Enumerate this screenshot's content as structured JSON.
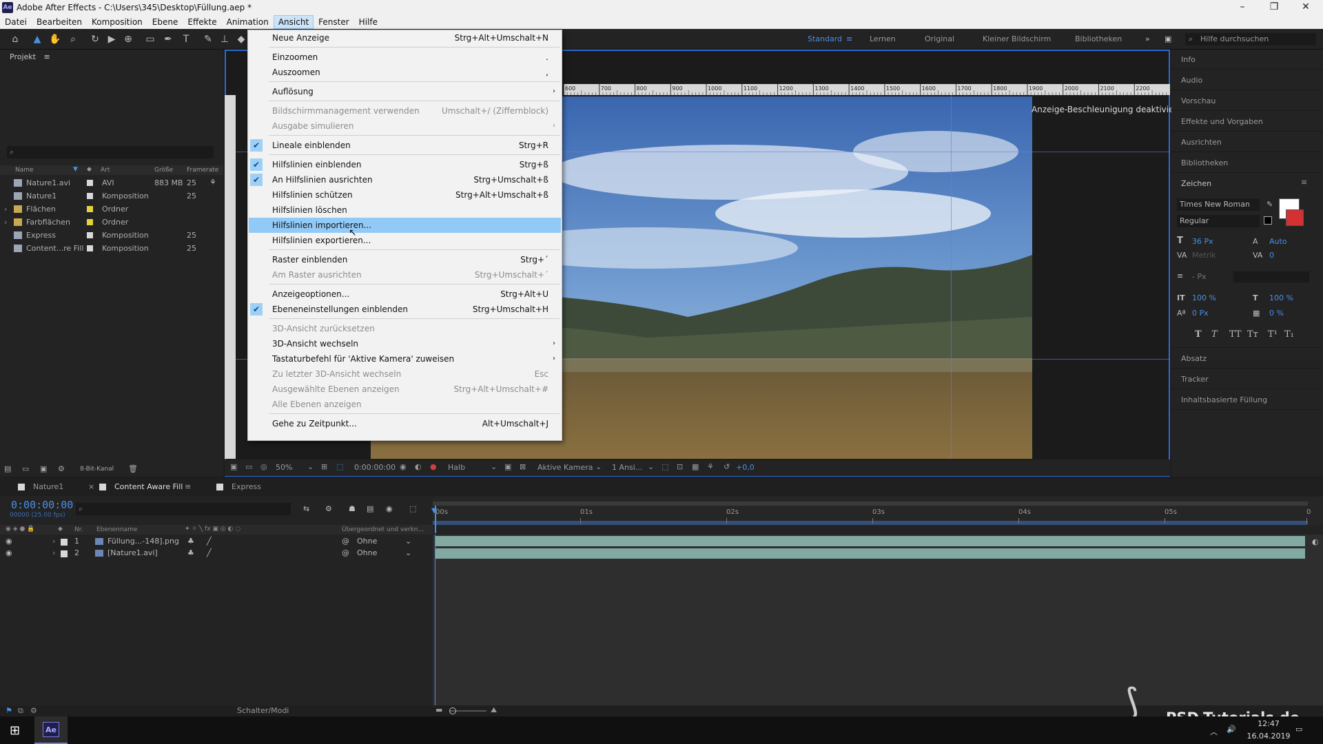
{
  "window": {
    "title": "Adobe After Effects - C:\\Users\\345\\Desktop\\Füllung.aep *",
    "logo": "Ae"
  },
  "menubar": {
    "items": [
      "Datei",
      "Bearbeiten",
      "Komposition",
      "Ebene",
      "Effekte",
      "Animation",
      "Ansicht",
      "Fenster",
      "Hilfe"
    ],
    "active": "Ansicht"
  },
  "workspaces": {
    "items": [
      "Standard",
      "Lernen",
      "Original",
      "Kleiner Bildschirm",
      "Bibliotheken"
    ],
    "active": "Standard",
    "help_placeholder": "Hilfe durchsuchen"
  },
  "project_panel": {
    "title": "Projekt",
    "columns": [
      "Name",
      "Art",
      "Größe",
      "Framerate"
    ],
    "rows": [
      {
        "name": "Nature1.avi",
        "type": "AVI",
        "size": "883 MB",
        "fps": "25",
        "color": "#d8d8d8"
      },
      {
        "name": "Nature1",
        "type": "Komposition",
        "size": "",
        "fps": "25",
        "color": "#d8d8d8"
      },
      {
        "name": "Flächen",
        "type": "Ordner",
        "size": "",
        "fps": "",
        "color": "#e3d13d"
      },
      {
        "name": "Farbflächen",
        "type": "Ordner",
        "size": "",
        "fps": "",
        "color": "#e3d13d"
      },
      {
        "name": "Express",
        "type": "Komposition",
        "size": "",
        "fps": "25",
        "color": "#d8d8d8"
      },
      {
        "name": "Content...re Fill",
        "type": "Komposition",
        "size": "",
        "fps": "25",
        "color": "#d8d8d8"
      }
    ],
    "footer_bit": "8-Bit-Kanal"
  },
  "viewer": {
    "accel_msg": "Anzeige-Beschleunigung deaktiviert",
    "zoom": "50%",
    "timecode": "0:00:00:00",
    "resolution": "Halb",
    "camera": "Aktive Kamera",
    "views": "1 Ansi...",
    "exposure": "+0,0",
    "ruler_labels": [
      "600",
      "700",
      "800",
      "900",
      "1000",
      "1100",
      "1200",
      "1300",
      "1400",
      "1500",
      "1600",
      "1700",
      "1800",
      "1900",
      "2000",
      "2100",
      "2200"
    ]
  },
  "right_panel": {
    "items": [
      "Info",
      "Audio",
      "Vorschau",
      "Effekte und Vorgaben",
      "Ausrichten",
      "Bibliotheken"
    ],
    "zeichen": {
      "title": "Zeichen",
      "font": "Times New Roman",
      "style": "Regular",
      "size": "36 Px",
      "leading": "Auto",
      "kerning": "Metrik",
      "tracking": "0",
      "stroke": "- Px",
      "vscale": "100 %",
      "hscale": "100 %",
      "baseline": "0 Px",
      "tsume": "0 %",
      "styles": [
        "T",
        "T",
        "TT",
        "Tт",
        "T¹",
        "T₁"
      ]
    },
    "lower_items": [
      "Absatz",
      "Tracker",
      "Inhaltsbasierte Füllung"
    ]
  },
  "timeline": {
    "tabs": [
      {
        "label": "Nature1",
        "active": false
      },
      {
        "label": "Content Aware Fill",
        "active": true
      },
      {
        "label": "Express",
        "active": false
      }
    ],
    "time": "0:00:00:00",
    "fps": "00000 (25.00 fps)",
    "col_nr": "Nr.",
    "col_name": "Ebenenname",
    "col_parent": "Übergeordnet und verkn...",
    "layers": [
      {
        "nr": "1",
        "name": "Füllung...-148].png",
        "parent": "Ohne"
      },
      {
        "nr": "2",
        "name": "[Nature1.avi]",
        "parent": "Ohne"
      }
    ],
    "ruler_marks": [
      "00s",
      "01s",
      "02s",
      "03s",
      "04s",
      "05s",
      "0"
    ],
    "footer": "Schalter/Modi"
  },
  "dropdown": {
    "items": [
      {
        "label": "Neue Anzeige",
        "shortcut": "Strg+Alt+Umschalt+N"
      },
      {
        "sep": true
      },
      {
        "label": "Einzoomen",
        "shortcut": "."
      },
      {
        "label": "Auszoomen",
        "shortcut": ","
      },
      {
        "sep": true
      },
      {
        "label": "Auflösung",
        "submenu": true
      },
      {
        "sep": true
      },
      {
        "label": "Bildschirmmanagement verwenden",
        "shortcut": "Umschalt+/ (Ziffernblock)",
        "disabled": true
      },
      {
        "label": "Ausgabe simulieren",
        "submenu": true,
        "disabled": true
      },
      {
        "sep": true
      },
      {
        "label": "Lineale einblenden",
        "shortcut": "Strg+R",
        "checked": true
      },
      {
        "sep": true
      },
      {
        "label": "Hilfslinien einblenden",
        "shortcut": "Strg+ß",
        "checked": true
      },
      {
        "label": "An Hilfslinien ausrichten",
        "shortcut": "Strg+Umschalt+ß",
        "checked": true
      },
      {
        "label": "Hilfslinien schützen",
        "shortcut": "Strg+Alt+Umschalt+ß"
      },
      {
        "label": "Hilfslinien löschen"
      },
      {
        "label": "Hilfslinien importieren...",
        "highlighted": true
      },
      {
        "label": "Hilfslinien exportieren..."
      },
      {
        "sep": true
      },
      {
        "label": "Raster einblenden",
        "shortcut": "Strg+´"
      },
      {
        "label": "Am Raster ausrichten",
        "shortcut": "Strg+Umschalt+´",
        "disabled": true
      },
      {
        "sep": true
      },
      {
        "label": "Anzeigeoptionen...",
        "shortcut": "Strg+Alt+U"
      },
      {
        "label": "Ebeneneinstellungen einblenden",
        "shortcut": "Strg+Umschalt+H",
        "checked": true
      },
      {
        "sep": true
      },
      {
        "label": "3D-Ansicht zurücksetzen",
        "disabled": true
      },
      {
        "label": "3D-Ansicht wechseln",
        "submenu": true
      },
      {
        "label": "Tastaturbefehl für 'Aktive Kamera' zuweisen",
        "submenu": true
      },
      {
        "label": "Zu letzter 3D-Ansicht wechseln",
        "shortcut": "Esc",
        "disabled": true
      },
      {
        "label": "Ausgewählte Ebenen anzeigen",
        "shortcut": "Strg+Alt+Umschalt+#",
        "disabled": true
      },
      {
        "label": "Alle Ebenen anzeigen",
        "disabled": true
      },
      {
        "sep": true
      },
      {
        "label": "Gehe zu Zeitpunkt...",
        "shortcut": "Alt+Umschalt+J"
      }
    ]
  },
  "taskbar": {
    "time": "12:47",
    "date": "16.04.2019",
    "app": "Ae"
  },
  "watermark": "PSD-Tutorials.de"
}
